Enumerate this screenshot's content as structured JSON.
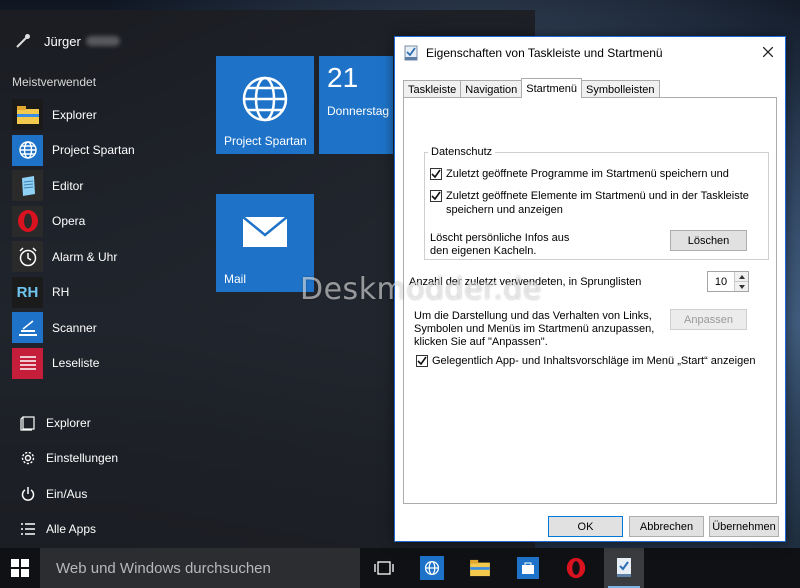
{
  "start_menu": {
    "user_name": "Jürger",
    "section_title": "Meistverwendet",
    "apps": [
      {
        "label": "Explorer",
        "icon": "file-explorer-icon"
      },
      {
        "label": "Project Spartan",
        "icon": "globe-icon"
      },
      {
        "label": "Editor",
        "icon": "notepad-icon"
      },
      {
        "label": "Opera",
        "icon": "opera-icon"
      },
      {
        "label": "Alarm & Uhr",
        "icon": "alarm-clock-icon"
      },
      {
        "label": "RH",
        "icon": "rh-icon"
      },
      {
        "label": "Scanner",
        "icon": "scanner-icon"
      },
      {
        "label": "Leseliste",
        "icon": "reading-list-icon"
      }
    ],
    "system": [
      {
        "label": "Explorer",
        "icon": "folder-icon"
      },
      {
        "label": "Einstellungen",
        "icon": "gear-icon"
      },
      {
        "label": "Ein/Aus",
        "icon": "power-icon"
      },
      {
        "label": "Alle Apps",
        "icon": "list-icon"
      }
    ],
    "tiles": {
      "spartan": {
        "label": "Project Spartan"
      },
      "calendar": {
        "day_number": "21",
        "day_name": "Donnerstag"
      },
      "mail": {
        "label": "Mail"
      }
    }
  },
  "taskbar": {
    "search_placeholder": "Web und Windows durchsuchen"
  },
  "dialog": {
    "title": "Eigenschaften von Taskleiste und Startmenü",
    "tabs": [
      "Taskleiste",
      "Navigation",
      "Startmenü",
      "Symbolleisten"
    ],
    "active_tab": "Startmenü",
    "group_title": "Datenschutz",
    "checkbox_programs": "Zuletzt geöffnete Programme im Startmenü speichern und",
    "checkbox_elements_line1": "Zuletzt geöffnete Elemente im Startmenü und in der Taskleiste",
    "checkbox_elements_line2": "speichern und anzeigen",
    "clear_text_line1": "Löscht persönliche Infos aus",
    "clear_text_line2": "den eigenen Kacheln.",
    "clear_button": "Löschen",
    "jumplist_label": "Anzahl der zuletzt verwendeten, in Sprunglisten",
    "jumplist_value": "10",
    "customize_text_line1": "Um die Darstellung und das Verhalten von Links,",
    "customize_text_line2": "Symbolen und Menüs im Startmenü anzupassen,",
    "customize_text_line3": "klicken Sie auf \"Anpassen\".",
    "customize_button": "Anpassen",
    "suggestions_checkbox": "Gelegentlich App- und Inhaltsvorschläge im Menü „Start“ anzeigen",
    "ok_button": "OK",
    "cancel_button": "Abbrechen",
    "apply_button": "Übernehmen",
    "checkbox_states": {
      "programs": true,
      "elements": true,
      "suggestions": true
    }
  },
  "watermark": "Deskmodder.de",
  "colors": {
    "tile_blue": "#1e73c8",
    "accent": "#0078d7"
  }
}
